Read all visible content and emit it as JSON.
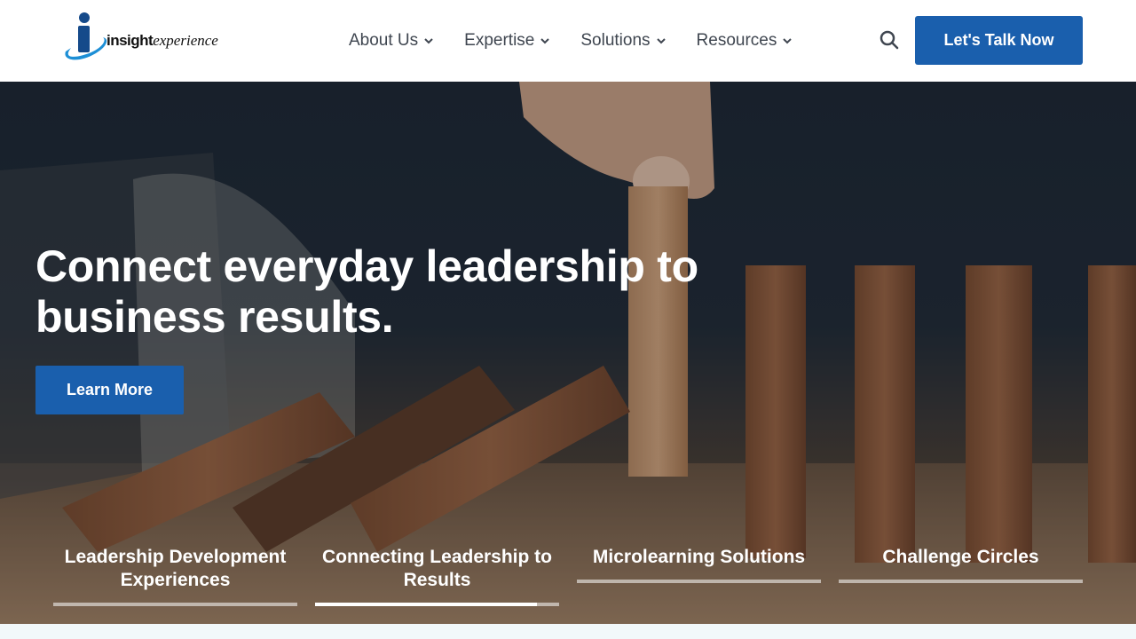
{
  "brand": {
    "word_bold": "insight",
    "word_italic": "experience",
    "colors": {
      "primary": "#1a5fad",
      "logo_blue": "#1d8fd6",
      "logo_dark": "#154a8a"
    }
  },
  "nav": {
    "items": [
      {
        "label": "About Us",
        "icon": "chevron-down-icon"
      },
      {
        "label": "Expertise",
        "icon": "chevron-down-icon"
      },
      {
        "label": "Solutions",
        "icon": "chevron-down-icon"
      },
      {
        "label": "Resources",
        "icon": "chevron-down-icon"
      }
    ],
    "search_icon": "search-icon",
    "cta_label": "Let's Talk Now"
  },
  "hero": {
    "headline": "Connect everyday leadership to business results.",
    "button_label": "Learn More",
    "tabs": [
      {
        "label": "Leadership Development Experiences",
        "progress": 0
      },
      {
        "label": "Connecting Leadership to Results",
        "progress": 0.91
      },
      {
        "label": "Microlearning Solutions",
        "progress": 0
      },
      {
        "label": "Challenge Circles",
        "progress": 0
      }
    ]
  }
}
